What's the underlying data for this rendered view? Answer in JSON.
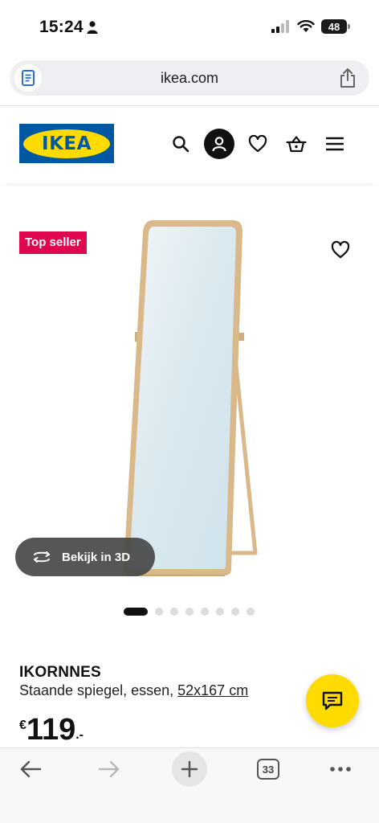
{
  "status_bar": {
    "time": "15:24",
    "battery": "48"
  },
  "browser": {
    "url": "ikea.com",
    "tab_count": "33"
  },
  "header": {
    "logo_text": "IKEA"
  },
  "product": {
    "badge": "Top seller",
    "view_3d_label": "Bekijk in 3D",
    "name": "IKORNNES",
    "description": "Staande spiegel, essen,",
    "dimensions": "52x167 cm",
    "price_currency": "€",
    "price_amount": "119",
    "price_decimals": ".-",
    "carousel_total": 8,
    "carousel_active": 1
  },
  "colors": {
    "ikea_blue": "#0058a3",
    "ikea_yellow": "#ffdb00",
    "badge_red": "#e00751",
    "mirror_wood": "#d9b98a"
  }
}
